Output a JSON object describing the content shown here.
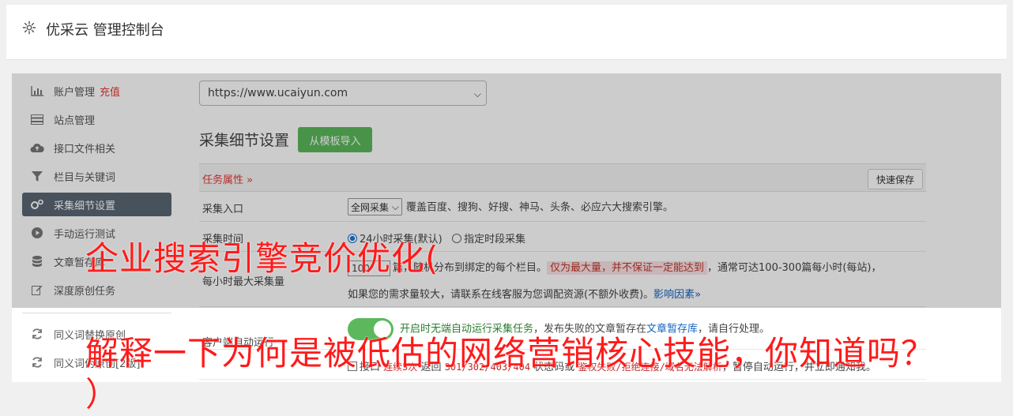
{
  "header": {
    "title": "优采云 管理控制台"
  },
  "sidebar": {
    "items": [
      {
        "label": "账户管理",
        "badge": "充值",
        "icon": "bar-chart-icon"
      },
      {
        "label": "站点管理",
        "icon": "server-icon"
      },
      {
        "label": "接口文件相关",
        "icon": "cloud-upload-icon"
      },
      {
        "label": "栏目与关键词",
        "icon": "filter-icon"
      },
      {
        "label": "采集细节设置",
        "icon": "cogs-icon",
        "active": true
      },
      {
        "label": "手动运行测试",
        "icon": "play-circle-icon"
      },
      {
        "label": "文章暂存库",
        "icon": "database-icon"
      },
      {
        "label": "深度原创任务",
        "icon": "edit-icon"
      },
      {
        "label": "同义词替换原创",
        "icon": "refresh-icon"
      },
      {
        "label": "同义词伪原创[2版]",
        "icon": "refresh-icon"
      }
    ]
  },
  "main": {
    "site_url": "https://www.ucaiyun.com",
    "section_title": "采集细节设置",
    "import_button": "从模板导入",
    "task_label": "任务属性 »",
    "quick_save": "快速保存",
    "rows": {
      "entry": {
        "label": "采集入口",
        "select": "全网采集",
        "desc": "覆盖百度、搜狗、好搜、神马、头条、必应六大搜索引擎。"
      },
      "time": {
        "label": "采集时间",
        "opt1": "24小时采集(默认)",
        "opt2": "指定时段采集"
      },
      "max": {
        "label": "每小时最大采集量",
        "value": "100",
        "text1": "篇，随机分布到绑定的每个栏目。",
        "warn": "仅为最大量，并不保证一定能达到",
        "text2": "，通常可达100-300篇每小时(每站)，",
        "text3": "如果您的需求量较大，请联系在线客服为您调配资源(不额外收费)。",
        "link": "影响因素»"
      },
      "auto": {
        "label": "客户端自动运行",
        "green": "开启时无端自动运行采集任务",
        "text": "，发布失败的文章暂存在",
        "link": "文章暂存库",
        "text2": "，请自行处理。"
      },
      "iface": {
        "text1": "接口",
        "red1": "连续5次",
        "text2": "返回",
        "codes": "301/302/403/404",
        "text3": "状态码或",
        "red2": "鉴权失败/拒绝连接/域名无法解析",
        "text4": "，暂停自动运行，并立即通知我。"
      }
    }
  },
  "watermark": {
    "line1": "企业搜索引擎竞价优化(",
    "line2": "解释一下为何是被低估的网络营销核心技能，你知道吗？",
    "line3": "）"
  },
  "colors": {
    "active_nav": "#5b6773",
    "accent_green": "#5cb85c",
    "alert_red": "#e53935",
    "watermark_red": "#ff1a1a"
  }
}
